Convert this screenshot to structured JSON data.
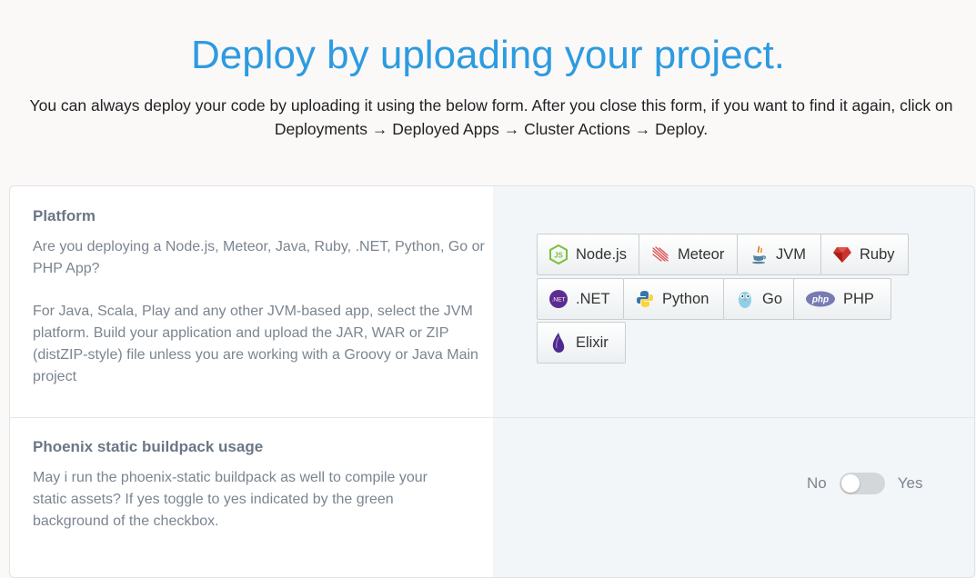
{
  "header": {
    "title": "Deploy by uploading your project.",
    "intro_line1": "You can always deploy your code by uploading it using the below form. After you close this form, if you want to find it again, click on",
    "intro_line2": "Deployments → Deployed Apps → Cluster Actions → Deploy."
  },
  "platform": {
    "title": "Platform",
    "desc1": "Are you deploying a Node.js, Meteor, Java, Ruby, .NET, Python, Go or PHP App?",
    "desc2": "For Java, Scala, Play and any other JVM-based app, select the JVM platform. Build your application and upload the JAR, WAR or ZIP (distZIP-style) file unless you are working with a Groovy or Java Main project",
    "options": [
      {
        "label": "Node.js",
        "icon": "nodejs-icon"
      },
      {
        "label": "Meteor",
        "icon": "meteor-icon"
      },
      {
        "label": "JVM",
        "icon": "java-icon"
      },
      {
        "label": "Ruby",
        "icon": "ruby-icon"
      },
      {
        "label": ".NET",
        "icon": "dotnet-icon"
      },
      {
        "label": "Python",
        "icon": "python-icon"
      },
      {
        "label": "Go",
        "icon": "go-gopher-icon"
      },
      {
        "label": "PHP",
        "icon": "php-icon"
      },
      {
        "label": "Elixir",
        "icon": "elixir-icon"
      }
    ],
    "dotnet_icon_text": ".NET",
    "php_icon_text": "php"
  },
  "phoenix": {
    "title": "Phoenix static buildpack usage",
    "desc": "May i run the phoenix-static buildpack as well to compile your static assets? If yes toggle to yes indicated by the green background of the checkbox.",
    "no_label": "No",
    "yes_label": "Yes",
    "enabled": false
  },
  "colors": {
    "accent": "#2d9be0",
    "toggle_off": "#d4d7da"
  }
}
